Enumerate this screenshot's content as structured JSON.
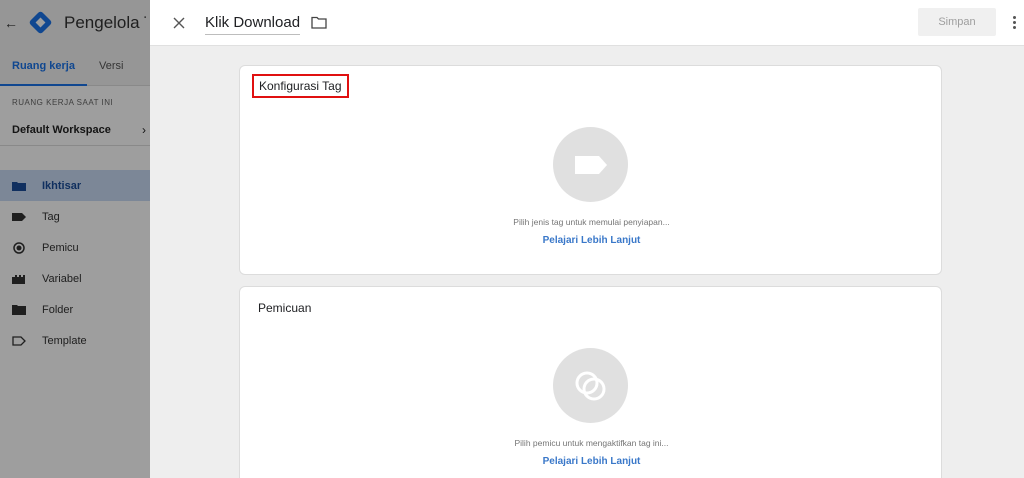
{
  "background_app": {
    "title": "Pengelola Tag Google",
    "back_icon": "arrow-back-icon",
    "tabs": [
      {
        "label": "Ruang kerja",
        "active": true
      },
      {
        "label": "Versi",
        "active": false
      }
    ],
    "workspace_label": "RUANG KERJA SAAT INI",
    "workspace_name": "Default Workspace",
    "nav": [
      {
        "label": "Ikhtisar",
        "icon": "folder-open-icon",
        "active": true
      },
      {
        "label": "Tag",
        "icon": "tag-icon",
        "active": false
      },
      {
        "label": "Pemicu",
        "icon": "trigger-icon",
        "active": false
      },
      {
        "label": "Variabel",
        "icon": "variable-icon",
        "active": false
      },
      {
        "label": "Folder",
        "icon": "folder-icon",
        "active": false
      },
      {
        "label": "Template",
        "icon": "template-icon",
        "active": false
      }
    ]
  },
  "panel": {
    "tag_name": "Klik Download",
    "save_label": "Simpan",
    "cards": [
      {
        "title": "Konfigurasi Tag",
        "hint": "Pilih jenis tag untuk memulai penyiapan...",
        "link": "Pelajari Lebih Lanjut",
        "icon": "tag-icon"
      },
      {
        "title": "Pemicuan",
        "hint": "Pilih pemicu untuk mengaktifkan tag ini...",
        "link": "Pelajari Lebih Lanjut",
        "icon": "trigger-icon"
      }
    ]
  },
  "colors": {
    "accent": "#1a73e8",
    "highlight_border": "#e01010",
    "link": "#3a78c9"
  }
}
